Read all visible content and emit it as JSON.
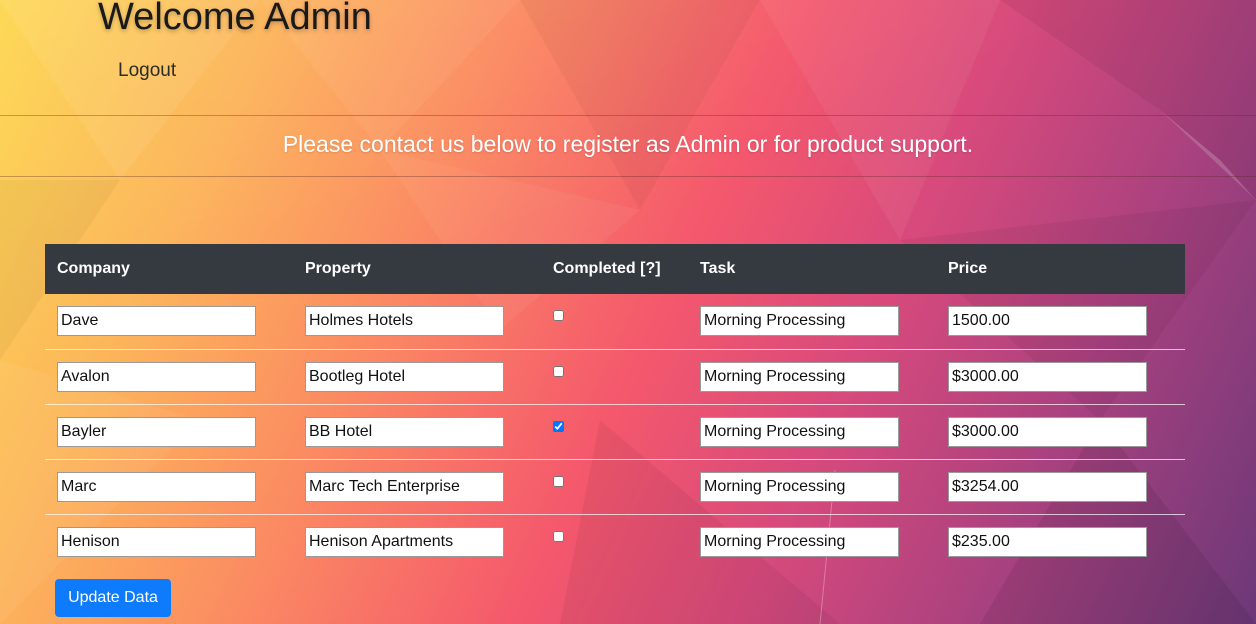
{
  "header": {
    "title": "Welcome Admin",
    "logout_label": "Logout"
  },
  "notice": "Please contact us below to register as Admin or for product support.",
  "table": {
    "columns": [
      "Company",
      "Property",
      "Completed [?]",
      "Task",
      "Price"
    ],
    "rows": [
      {
        "company": "Dave",
        "property": "Holmes Hotels",
        "completed": false,
        "task": "Morning Processing",
        "price": "1500.00"
      },
      {
        "company": "Avalon",
        "property": "Bootleg Hotel",
        "completed": false,
        "task": "Morning Processing",
        "price": "$3000.00"
      },
      {
        "company": "Bayler",
        "property": "BB Hotel",
        "completed": true,
        "task": "Morning Processing",
        "price": "$3000.00"
      },
      {
        "company": "Marc",
        "property": "Marc Tech Enterprise",
        "completed": false,
        "task": "Morning Processing",
        "price": "$3254.00"
      },
      {
        "company": "Henison",
        "property": "Henison Apartments",
        "completed": false,
        "task": "Morning Processing",
        "price": "$235.00"
      }
    ]
  },
  "update_button_label": "Update Data",
  "colors": {
    "header_bg": "#343a40",
    "button_bg": "#0d7bfc"
  }
}
